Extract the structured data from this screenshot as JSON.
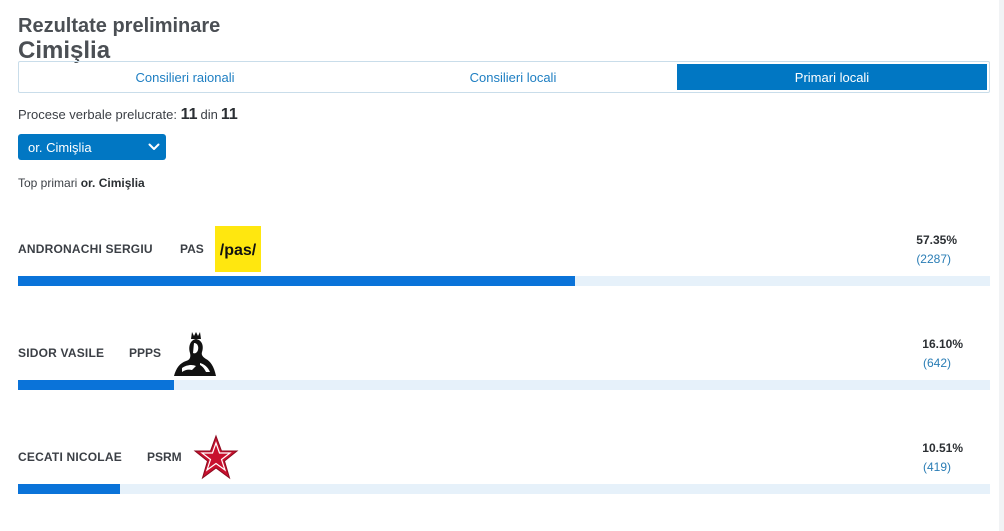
{
  "header": {
    "title": "Rezultate preliminare",
    "subtitle": "Cimişlia"
  },
  "tabs": [
    {
      "label": "Consilieri raionali",
      "active": false
    },
    {
      "label": "Consilieri locali",
      "active": false
    },
    {
      "label": "Primari locali",
      "active": true
    }
  ],
  "processed": {
    "label": "Procese verbale prelucrate:",
    "done": "11",
    "separator": "din",
    "total": "11"
  },
  "locality_select": {
    "value": "or. Cimişlia"
  },
  "top_label": {
    "prefix": "Top primari",
    "locality": "or. Cimişlia"
  },
  "candidates": [
    {
      "name": "ANDRONACHI SERGIU",
      "party": "PAS",
      "logo": "pas-logo",
      "logo_text": "/pas/",
      "percent_label": "57.35%",
      "votes_label": "(2287)",
      "share": 57.35
    },
    {
      "name": "SIDOR VASILE",
      "party": "PPPS",
      "logo": "ppps-logo",
      "percent_label": "16.10%",
      "votes_label": "(642)",
      "share": 16.1
    },
    {
      "name": "CECATI NICOLAE",
      "party": "PSRM",
      "logo": "psrm-star-logo",
      "percent_label": "10.51%",
      "votes_label": "(419)",
      "share": 10.51
    }
  ],
  "colors": {
    "accent": "#0177c3",
    "bar": "#0a73d9",
    "bar_track": "#e6f1fa",
    "pas_yellow": "#ffe70f",
    "psrm_red": "#c8102e"
  }
}
